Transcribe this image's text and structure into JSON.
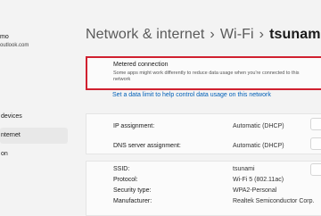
{
  "sidebar": {
    "user_name": "mo",
    "user_email": "outlook.com",
    "items": [
      {
        "label": "devices",
        "selected": false
      },
      {
        "label": "nternet",
        "selected": true
      },
      {
        "label": "on",
        "selected": false
      }
    ]
  },
  "header": {
    "breadcrumb_1": "Network & internet",
    "breadcrumb_2": "Wi-Fi",
    "current": "tsunami",
    "separator": "›"
  },
  "metered": {
    "title": "Metered connection",
    "description": "Some apps might work differently to reduce data usage when you're connected to this network",
    "highlight_color": "#d0202f"
  },
  "data_limit_link": "Set a data limit to help control data usage on this network",
  "properties": {
    "ip_assignment": {
      "label": "IP assignment:",
      "value": "Automatic (DHCP)"
    },
    "dns_assignment": {
      "label": "DNS server assignment:",
      "value": "Automatic (DHCP)"
    },
    "ssid": {
      "label": "SSID:",
      "value": "tsunami"
    },
    "protocol": {
      "label": "Protocol:",
      "value": "Wi-Fi 5 (802.11ac)"
    },
    "security": {
      "label": "Security type:",
      "value": "WPA2-Personal"
    },
    "manufacturer": {
      "label": "Manufacturer:",
      "value": "Realtek Semiconductor Corp."
    }
  }
}
